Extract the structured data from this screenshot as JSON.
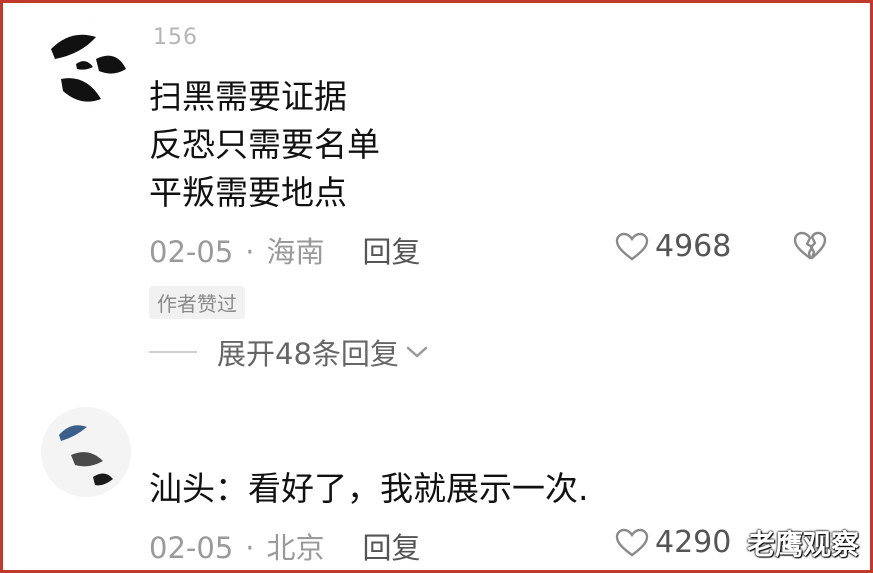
{
  "comments": [
    {
      "username": "156",
      "lines": [
        "扫黑需要证据",
        "反恐只需要名单",
        "平叛需要地点"
      ],
      "date": "02-05",
      "separator": "·",
      "location": "海南",
      "reply_label": "回复",
      "likes": "4968",
      "badge": "作者赞过",
      "expand_label": "展开48条回复"
    },
    {
      "username": "",
      "lines": [
        "汕头：看好了，我就展示一次."
      ],
      "date": "02-05",
      "separator": "·",
      "location": "北京",
      "reply_label": "回复",
      "likes": "4290"
    }
  ],
  "watermark": "老鹰观察",
  "colors": {
    "frame_border": "#c0392b",
    "text_primary": "#111111",
    "text_meta": "#9a9a9a"
  },
  "icons": [
    "heart-outline-icon",
    "broken-heart-icon",
    "chevron-down-icon"
  ]
}
